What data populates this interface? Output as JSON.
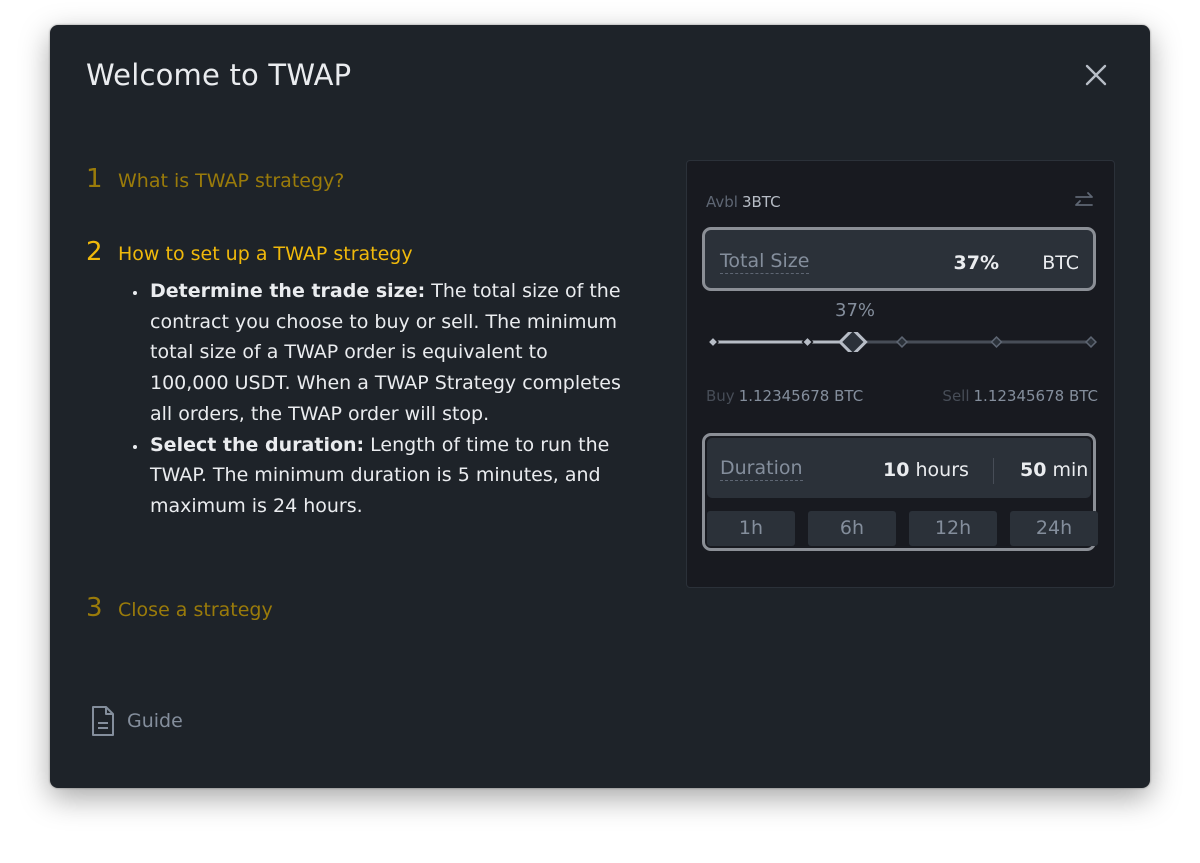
{
  "modal": {
    "title": "Welcome to TWAP"
  },
  "steps": [
    {
      "number": "1",
      "title": "What is TWAP strategy?",
      "state": "collapsed"
    },
    {
      "number": "2",
      "title": "How to set up a TWAP strategy",
      "state": "expanded"
    },
    {
      "number": "3",
      "title": "Close a strategy",
      "state": "collapsed"
    }
  ],
  "step2_bullets": [
    {
      "bold": "Determine the trade size:",
      "text": " The total size of the contract you choose to buy or sell. The minimum total size of a TWAP order is equivalent to 100,000 USDT. When a TWAP Strategy completes all orders, the TWAP order will stop."
    },
    {
      "bold": "Select the duration:",
      "text": " Length of time to run the TWAP. The minimum duration is 5 minutes, and maximum is 24 hours."
    }
  ],
  "guide": {
    "label": "Guide",
    "icon": "document-icon"
  },
  "widget": {
    "avbl_label": "Avbl",
    "avbl_value": "3BTC",
    "total_size": {
      "label": "Total Size",
      "value": "37%",
      "unit": "BTC"
    },
    "slider": {
      "label": "37%",
      "percent": 37,
      "marks": [
        0,
        25,
        50,
        75,
        100
      ]
    },
    "buy": {
      "label": "Buy",
      "value": "1.12345678 BTC"
    },
    "sell": {
      "label": "Sell",
      "value": "1.12345678 BTC"
    },
    "duration": {
      "label": "Duration",
      "hours_value": "10",
      "hours_unit": "hours",
      "min_value": "50",
      "min_unit": "min",
      "presets": [
        "1h",
        "6h",
        "12h",
        "24h"
      ]
    }
  },
  "colors": {
    "accent": "#f0b90b",
    "accent_dim": "#9a7b0a",
    "background": "#1e2329",
    "text_primary": "#eaecef",
    "text_secondary": "#848e9c"
  }
}
